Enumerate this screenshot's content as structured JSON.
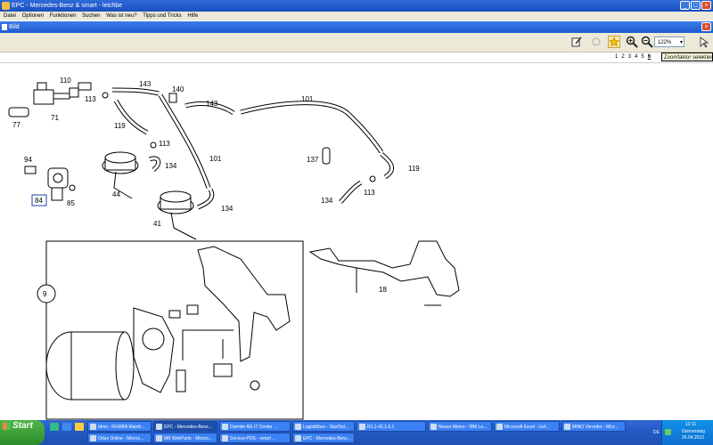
{
  "window": {
    "title": "EPC - Mercedes-Benz & smart - leichbe",
    "min_label": "_",
    "max_label": "□",
    "close_label": "×"
  },
  "menu": {
    "items": [
      "Datei",
      "Optionen",
      "Funktionen",
      "Suchen",
      "Was ist neu?",
      "Tipps und Tricks",
      "Hilfe"
    ]
  },
  "subwindow": {
    "title": "Bild",
    "close_label": "×"
  },
  "toolbar": {
    "zoom_value": "122%",
    "zoom_arrow": "▾",
    "tooltip": "Zoomfaktor selektieren"
  },
  "pages": {
    "items": [
      "1",
      "2",
      "3",
      "4",
      "5",
      "6"
    ]
  },
  "drawing": {
    "labels": {
      "l110": "110",
      "l143a": "143",
      "l140": "140",
      "l143b": "143",
      "l101a": "101",
      "l77": "77",
      "l71": "71",
      "l113a": "113",
      "l119a": "119",
      "l113b": "113",
      "l134a": "134",
      "l101b": "101",
      "l137": "137",
      "l119b": "119",
      "l94": "94",
      "l84": "84",
      "l85": "85",
      "l44": "44",
      "l113c": "113",
      "l134b": "134",
      "l134c": "134",
      "l41": "41",
      "l18": "18",
      "l9": "9"
    }
  },
  "taskbar": {
    "start_label": "Start",
    "tasks_top": [
      "Idms - RUMBA Mainfr...",
      "EPC - Mercedes-Benz...",
      "Daimler AG IT Center ...",
      "Logistikbox - StarOrd...",
      "R1.1-42.1.6.1",
      "Neues Memo - IBM Lo...",
      "Microsoft Excel - Lief...",
      "MINO Vororder - Micr..."
    ],
    "tasks_bottom": [
      "Odus Online - Micros...",
      "MB WebParts - Micros...",
      "Service-POS - smart ...",
      "EPC - Mercedes-Benz..."
    ],
    "tray": {
      "lang": "DE",
      "time": "12:11",
      "day": "Donnerstag",
      "date": "26.04.2012"
    }
  },
  "colors": {
    "titlebar": "#1a4fc0",
    "menubar": "#ece9d8",
    "taskbar": "#245bc5",
    "start": "#2d8c2a",
    "tray": "#0c6fd0"
  }
}
